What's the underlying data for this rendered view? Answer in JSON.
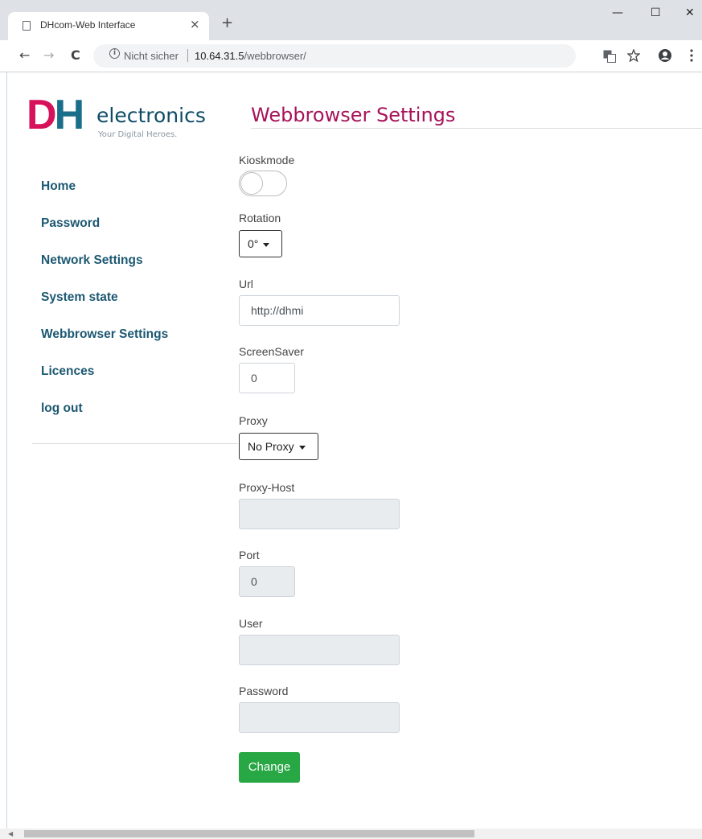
{
  "browser": {
    "tab_title": "DHcom-Web Interface",
    "tab_close": "×",
    "new_tab": "+",
    "window_minimize": "—",
    "window_maximize": "☐",
    "window_close": "✕",
    "back": "←",
    "forward": "→",
    "reload": "C",
    "security_label": "Nicht sicher",
    "url_host": "10.64.31.5",
    "url_path": "/webbrowser/",
    "icons": [
      "page-icon",
      "info-icon",
      "translate-icon",
      "star-icon",
      "account-icon",
      "menu-icon"
    ]
  },
  "logo": {
    "mark_d": "D",
    "mark_h": "H",
    "name": "electronics",
    "tagline": "Your Digital Heroes."
  },
  "nav": {
    "items": [
      {
        "label": "Home"
      },
      {
        "label": "Password"
      },
      {
        "label": "Network Settings"
      },
      {
        "label": "System state"
      },
      {
        "label": "Webbrowser Settings"
      },
      {
        "label": "Licences"
      },
      {
        "label": "log out"
      }
    ]
  },
  "form": {
    "title": "Webbrowser Settings",
    "kioskmode": {
      "label": "Kioskmode",
      "enabled": false
    },
    "rotation": {
      "label": "Rotation",
      "value": "0°"
    },
    "url": {
      "label": "Url",
      "value": "http://dhmi"
    },
    "screensaver": {
      "label": "ScreenSaver",
      "value": "0"
    },
    "proxy": {
      "label": "Proxy",
      "value": "No Proxy"
    },
    "proxy_host": {
      "label": "Proxy-Host",
      "value": ""
    },
    "port": {
      "label": "Port",
      "value": "0"
    },
    "user": {
      "label": "User",
      "value": ""
    },
    "password": {
      "label": "Password",
      "value": ""
    },
    "submit_label": "Change"
  },
  "colors": {
    "brand_magenta": "#a7135a",
    "brand_teal": "#1c5872",
    "button_green": "#28a745",
    "disabled_input": "#e9ecef"
  }
}
